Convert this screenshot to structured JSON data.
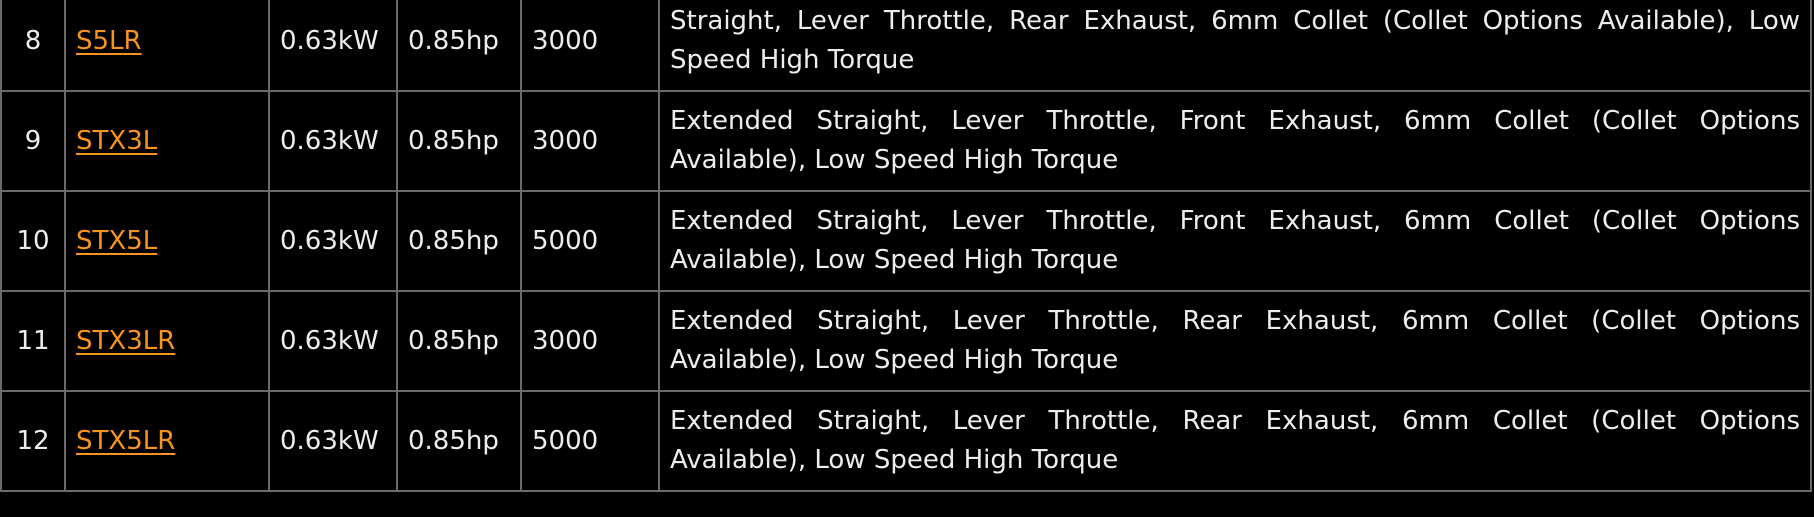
{
  "table": {
    "rows": [
      {
        "index": "8",
        "model": "S5LR",
        "kw": "0.63kW",
        "hp": "0.85hp",
        "rpm": "3000",
        "description": "Straight, Lever Throttle, Rear Exhaust, 6mm Collet (Collet Options Available), Low Speed High Torque"
      },
      {
        "index": "9",
        "model": "STX3L",
        "kw": "0.63kW",
        "hp": "0.85hp",
        "rpm": "3000",
        "description": "Extended Straight, Lever Throttle, Front Exhaust, 6mm Collet (Collet Options Available), Low Speed High Torque"
      },
      {
        "index": "10",
        "model": "STX5L",
        "kw": "0.63kW",
        "hp": "0.85hp",
        "rpm": "5000",
        "description": "Extended Straight, Lever Throttle, Front Exhaust, 6mm Collet (Collet Options Available), Low Speed High Torque"
      },
      {
        "index": "11",
        "model": "STX3LR",
        "kw": "0.63kW",
        "hp": "0.85hp",
        "rpm": "3000",
        "description": "Extended Straight, Lever Throttle, Rear Exhaust, 6mm Collet (Collet Options Available), Low Speed High Torque"
      },
      {
        "index": "12",
        "model": "STX5LR",
        "kw": "0.63kW",
        "hp": "0.85hp",
        "rpm": "5000",
        "description": "Extended Straight, Lever Throttle, Rear Exhaust, 6mm Collet (Collet Options Available), Low Speed High Torque"
      }
    ]
  },
  "colors": {
    "background": "#000000",
    "text": "#ededed",
    "link": "#f7941d",
    "border": "#6a6a6a"
  }
}
